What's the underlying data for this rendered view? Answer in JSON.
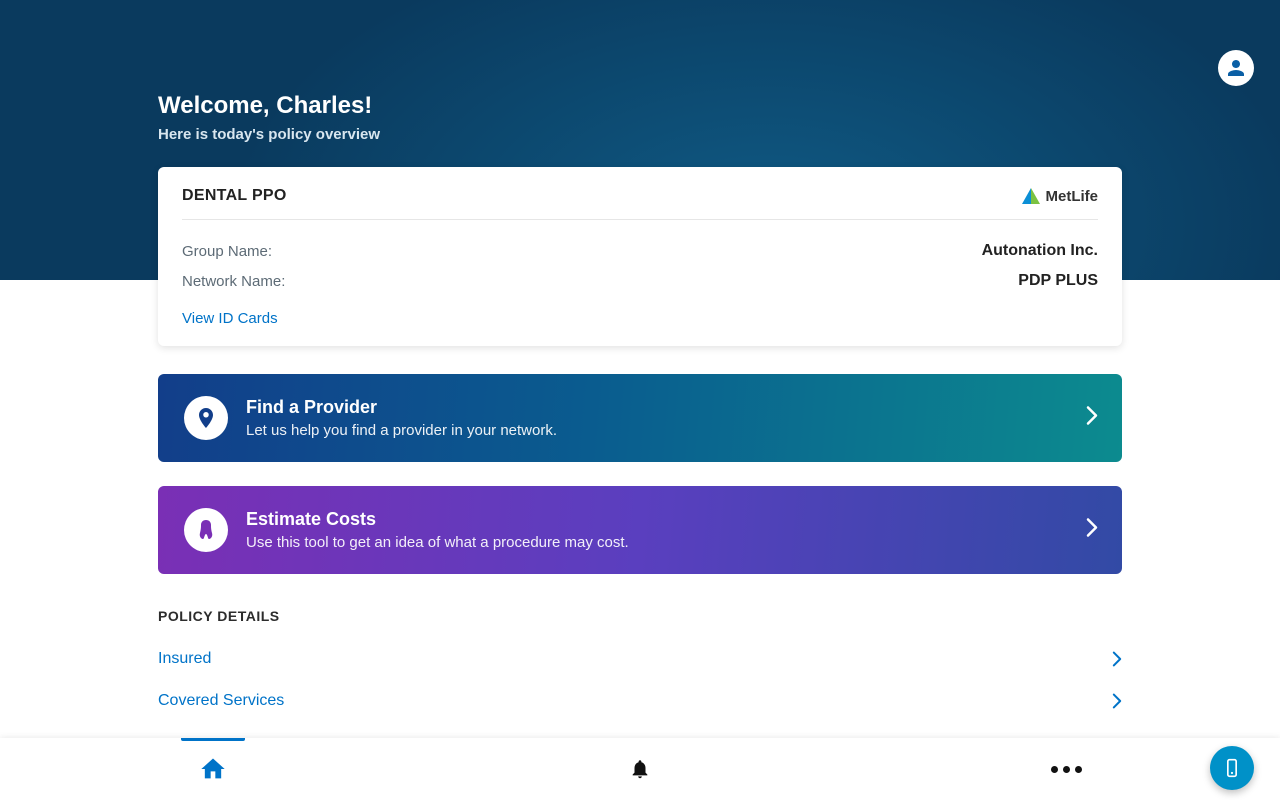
{
  "header": {
    "welcome": "Welcome, Charles!",
    "subtitle": "Here is today's policy overview"
  },
  "brand_name": "MetLife",
  "policy_card": {
    "plan_name": "DENTAL PPO",
    "group_label": "Group Name:",
    "group_value": "Autonation Inc.",
    "network_label": "Network Name:",
    "network_value": "PDP PLUS",
    "view_cards_link": "View ID Cards"
  },
  "actions": {
    "find_provider": {
      "title": "Find a Provider",
      "desc": "Let us help you find a provider in your network."
    },
    "estimate_costs": {
      "title": "Estimate Costs",
      "desc": "Use this tool to get an idea of what a procedure may cost."
    }
  },
  "policy_details": {
    "heading": "POLICY DETAILS",
    "items": [
      {
        "label": "Insured"
      },
      {
        "label": "Covered Services"
      }
    ]
  }
}
